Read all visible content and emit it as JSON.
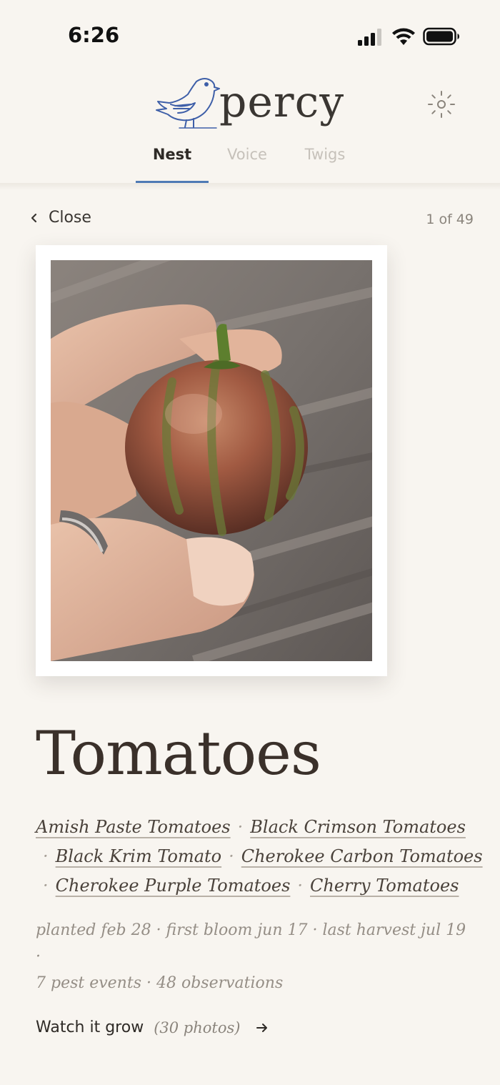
{
  "status_bar": {
    "time": "6:26"
  },
  "app": {
    "name": "percy"
  },
  "tabs": [
    {
      "label": "Nest",
      "active": true
    },
    {
      "label": "Voice",
      "active": false
    },
    {
      "label": "Twigs",
      "active": false
    }
  ],
  "nav": {
    "close_label": "Close",
    "counter": "1 of 49"
  },
  "plant": {
    "name": "Tomatoes",
    "varieties": [
      "Amish Paste Tomatoes",
      "Black Crimson Tomatoes",
      "Black Krim Tomato",
      "Cherokee Carbon Tomatoes",
      "Cherokee Purple Tomatoes",
      "Cherry Tomatoes"
    ],
    "meta_line1": "planted feb 28 · first bloom jun 17 · last harvest jul 19 ·",
    "meta_line2": "7 pest events · 48 observations"
  },
  "watch": {
    "label": "Watch it grow",
    "count": "(30 photos)"
  },
  "colors": {
    "accent": "#4f7ab5",
    "background": "#f8f5f0",
    "logo_blue": "#3e5fa8"
  },
  "icons": [
    "signal-icon",
    "wifi-icon",
    "battery-icon",
    "bird-logo-icon",
    "sun-settings-icon",
    "chevron-left-icon",
    "arrow-right-icon"
  ]
}
